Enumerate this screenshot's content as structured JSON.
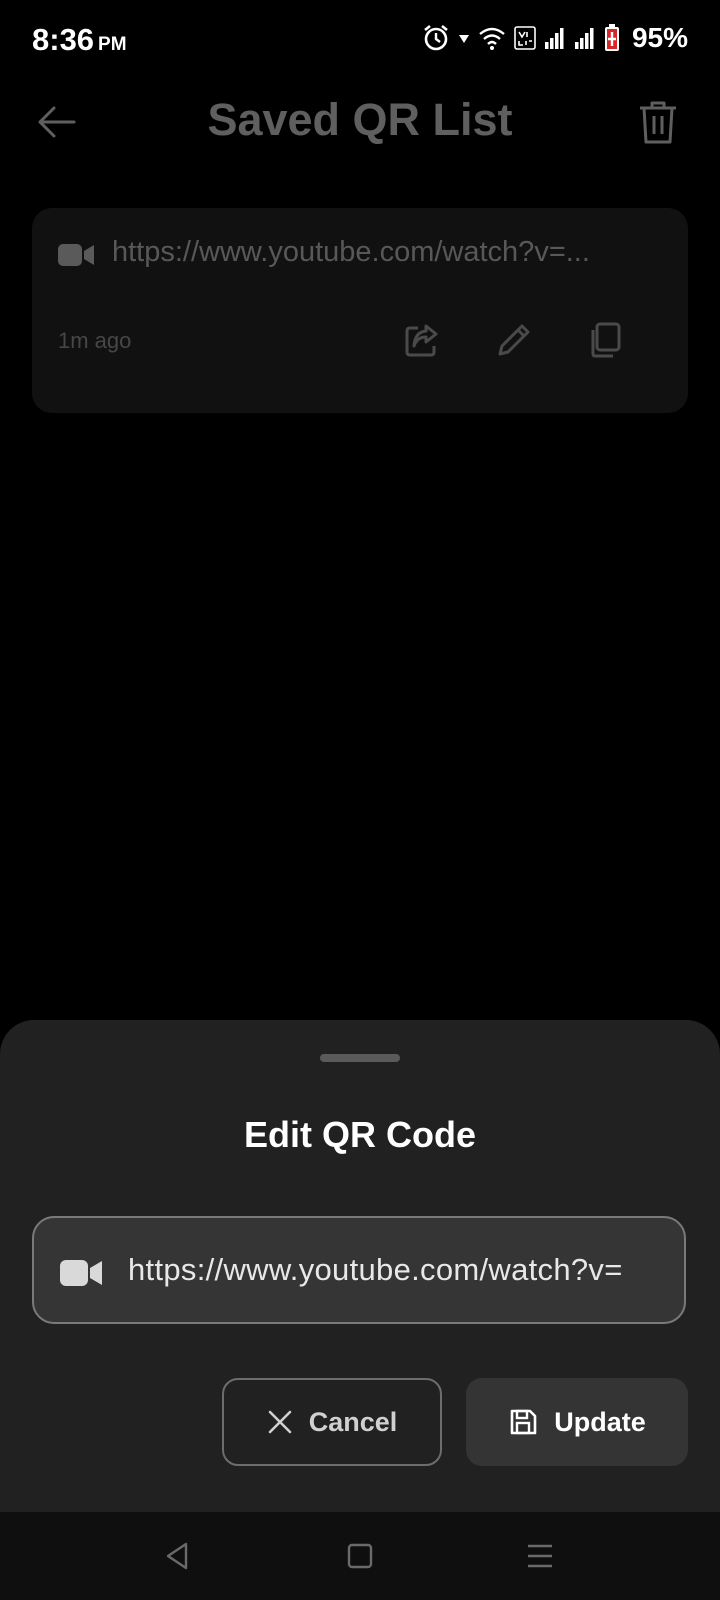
{
  "status_bar": {
    "time": "8:36",
    "ampm": "PM",
    "battery_percent": "95%",
    "icons": [
      "alarm-icon",
      "data-arrow-icon",
      "wifi-icon",
      "volte-icon",
      "signal-icon",
      "signal-icon",
      "battery-icon"
    ]
  },
  "app_bar": {
    "title": "Saved QR List",
    "back_icon": "arrow-left-icon",
    "delete_icon": "trash-icon"
  },
  "saved_list": [
    {
      "type_icon": "video-icon",
      "url": "https://www.youtube.com/watch?v=...",
      "time_ago": "1m ago",
      "actions": [
        "share-icon",
        "edit-icon",
        "copy-icon"
      ]
    }
  ],
  "edit_sheet": {
    "title": "Edit QR Code",
    "field_value": "https://www.youtube.com/watch?v=",
    "field_icon": "video-icon",
    "cancel_label": "Cancel",
    "update_label": "Update"
  },
  "nav_bar": {
    "icons": [
      "back-triangle-icon",
      "home-square-icon",
      "menu-lines-icon"
    ]
  },
  "colors": {
    "background": "#000000",
    "sheet": "#212121",
    "card": "#111111",
    "field": "#353535"
  }
}
